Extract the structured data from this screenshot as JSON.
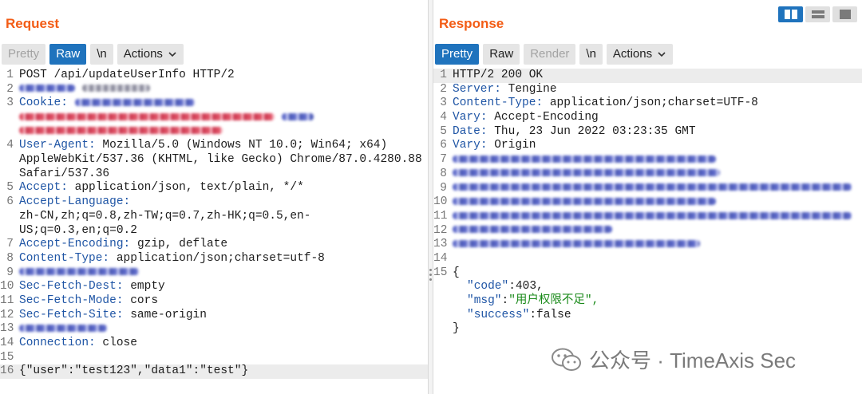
{
  "request": {
    "title": "Request",
    "tabs": {
      "pretty": "Pretty",
      "raw": "Raw",
      "newline": "\\n",
      "actions": "Actions"
    },
    "lines": [
      {
        "n": "1",
        "text": "POST /api/updateUserInfo HTTP/2"
      },
      {
        "n": "2"
      },
      {
        "n": "3",
        "key": "Cookie",
        "sep": ": "
      },
      {
        "n": "4",
        "key": "User-Agent",
        "sep": ": ",
        "value": "Mozilla/5.0 (Windows NT 10.0; Win64; x64) AppleWebKit/537.36 (KHTML, like Gecko) Chrome/87.0.4280.88 Safari/537.36"
      },
      {
        "n": "5",
        "key": "Accept",
        "sep": ": ",
        "value": "application/json, text/plain, */*"
      },
      {
        "n": "6",
        "key": "Accept-Language",
        "sep": ":",
        "value": "zh-CN,zh;q=0.8,zh-TW;q=0.7,zh-HK;q=0.5,en-US;q=0.3,en;q=0.2"
      },
      {
        "n": "7",
        "key": "Accept-Encoding",
        "sep": ": ",
        "value": "gzip, deflate"
      },
      {
        "n": "8",
        "key": "Content-Type",
        "sep": ": ",
        "value": "application/json;charset=utf-8"
      },
      {
        "n": "9"
      },
      {
        "n": "10",
        "key": "Sec-Fetch-Dest",
        "sep": ": ",
        "value": "empty"
      },
      {
        "n": "11",
        "key": "Sec-Fetch-Mode",
        "sep": ": ",
        "value": "cors"
      },
      {
        "n": "12",
        "key": "Sec-Fetch-Site",
        "sep": ": ",
        "value": "same-origin"
      },
      {
        "n": "13"
      },
      {
        "n": "14",
        "key": "Connection",
        "sep": ": ",
        "value": "close"
      },
      {
        "n": "15"
      },
      {
        "n": "16",
        "text": "{\"user\":\"test123\",\"data1\":\"test\"}"
      }
    ]
  },
  "response": {
    "title": "Response",
    "tabs": {
      "pretty": "Pretty",
      "raw": "Raw",
      "render": "Render",
      "newline": "\\n",
      "actions": "Actions"
    },
    "lines": [
      {
        "n": "1",
        "text": "HTTP/2 200 OK"
      },
      {
        "n": "2",
        "key": "Server",
        "sep": ": ",
        "value": "Tengine"
      },
      {
        "n": "3",
        "key": "Content-Type",
        "sep": ": ",
        "value": "application/json;charset=UTF-8"
      },
      {
        "n": "4",
        "key": "Vary",
        "sep": ": ",
        "value": "Accept-Encoding"
      },
      {
        "n": "5",
        "key": "Date",
        "sep": ": ",
        "value": "Thu, 23 Jun 2022 03:23:35 GMT"
      },
      {
        "n": "6",
        "key": "Vary",
        "sep": ": ",
        "value": "Origin"
      },
      {
        "n": "7"
      },
      {
        "n": "8"
      },
      {
        "n": "9"
      },
      {
        "n": "10"
      },
      {
        "n": "11"
      },
      {
        "n": "12"
      },
      {
        "n": "13"
      },
      {
        "n": "14"
      },
      {
        "n": "15",
        "text": "{"
      },
      {
        "key": "\"code\"",
        "sep": ":",
        "value": "403,"
      },
      {
        "key": "\"msg\"",
        "sep": ":",
        "value": "\"用户权限不足\","
      },
      {
        "key": "\"success\"",
        "sep": ":",
        "value": "false"
      },
      {
        "text": "}"
      }
    ]
  },
  "watermark": {
    "text": "公众号 · TimeAxis Sec"
  },
  "colors": {
    "accent": "#f35c15",
    "active_tab": "#1f73bd",
    "header_key": "#1f55a5"
  }
}
